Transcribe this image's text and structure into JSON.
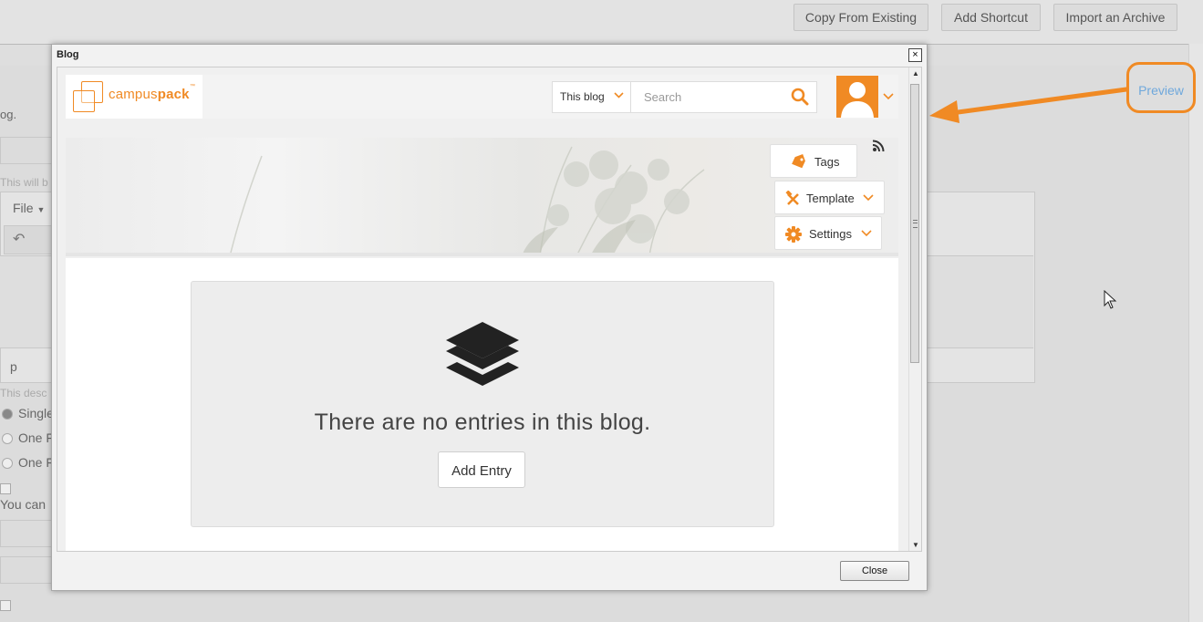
{
  "toolbar": {
    "copy_label": "Copy From Existing",
    "shortcut_label": "Add Shortcut",
    "import_label": "Import an Archive"
  },
  "background": {
    "frag_desc": "og.",
    "frag_help1": "This will b",
    "frag_file": "File",
    "frag_p": "p",
    "frag_help2": "This desc",
    "radio_single": "Single",
    "radio_one_a": "One F",
    "radio_one_b": "One F",
    "frag_you_can": "You can"
  },
  "preview_label": "Preview",
  "modal": {
    "title": "Blog",
    "close_x": "×",
    "close_label": "Close"
  },
  "campuspack": {
    "logo_light": "campus",
    "logo_bold": "pack",
    "logo_tm": "™",
    "scope_label": "This blog",
    "search_placeholder": "Search"
  },
  "blog_actions": {
    "tags": "Tags",
    "template": "Template",
    "settings": "Settings"
  },
  "empty_state": {
    "message": "There are no entries in this blog.",
    "add_entry": "Add Entry"
  },
  "colors": {
    "accent": "#f08a24",
    "link": "#6fa8dc"
  },
  "icons": [
    "layers-icon",
    "search-icon",
    "tag-icon",
    "tools-icon",
    "gear-icon",
    "rss-icon",
    "user-avatar-icon",
    "chevron-down-icon"
  ]
}
